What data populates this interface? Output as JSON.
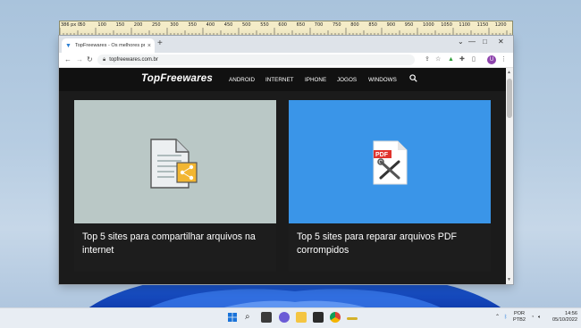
{
  "ruler": {
    "labels": [
      "386 px 0",
      "50",
      "100",
      "150",
      "200",
      "250",
      "300",
      "350",
      "400",
      "450",
      "500",
      "550",
      "600",
      "650",
      "700",
      "750",
      "800",
      "850",
      "900",
      "950",
      "1000",
      "1050",
      "1100",
      "1150",
      "1200"
    ]
  },
  "browser": {
    "tab_title": "TopFreewares - Os melhores pr...",
    "tab_close": "×",
    "new_tab": "+",
    "url": "topfreewares.com.br",
    "profile_initial": "U"
  },
  "site": {
    "logo": "TopFreewares",
    "nav": [
      "ANDROID",
      "INTERNET",
      "IPHONE",
      "JOGOS",
      "WINDOWS"
    ]
  },
  "cards": [
    {
      "title": "Top 5 sites para compartilhar arquivos na internet",
      "bg": "#bac8c6"
    },
    {
      "title": "Top 5 sites para reparar arquivos PDF corrompidos",
      "bg": "#3a95e8",
      "badge": "PDF"
    }
  ],
  "taskbar": {
    "lang_top": "POR",
    "lang_bottom": "PTB2",
    "time": "14:56",
    "date": "05/10/2022"
  },
  "colors": {
    "site_bg": "#1b1b1b",
    "accent_blue": "#3a95e8",
    "pdf_red": "#e0332d",
    "share_orange": "#f2b632"
  }
}
